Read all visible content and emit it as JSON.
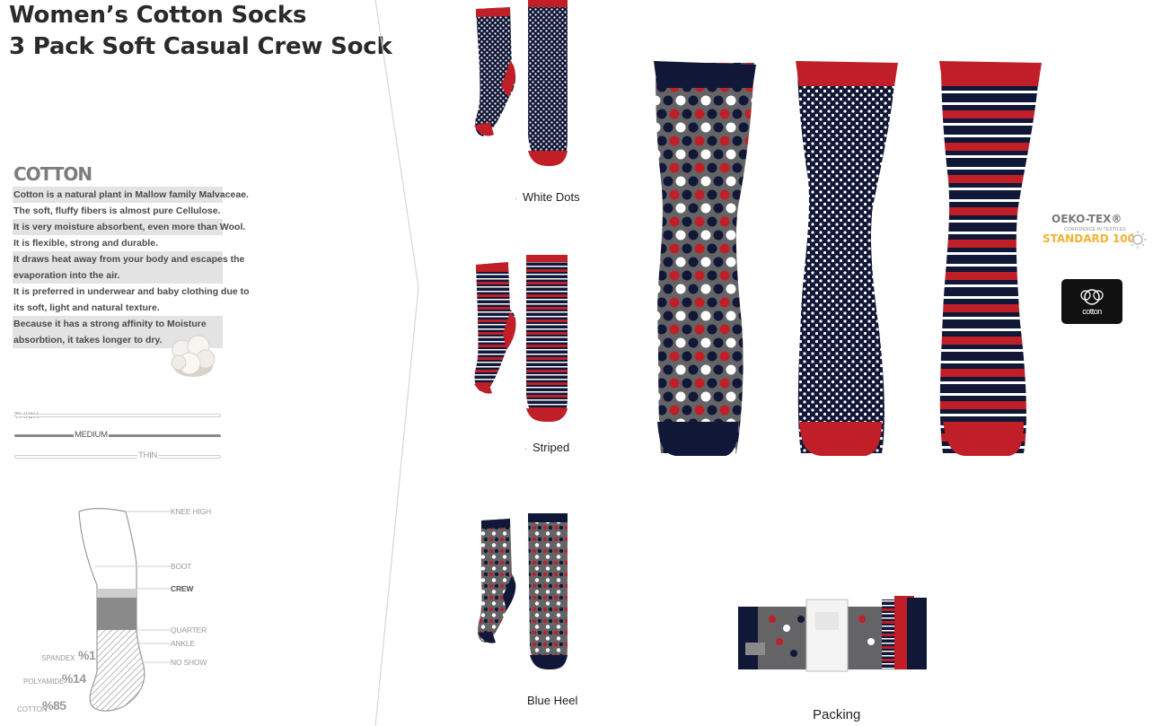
{
  "title": {
    "line1": "Women’s Cotton Socks",
    "line2": "3 Pack Soft Casual Crew Sock"
  },
  "cotton_info": {
    "heading": "COTTON",
    "lines": [
      "Cotton is a natural plant in Mallow family Malvaceae.",
      "The soft, fluffy fibers is almost pure Cellulose.",
      "It is very  moisture absorbent, even more than Wool.",
      "It is flexible, strong and durable.",
      "It draws heat away from your body and escapes the",
      "evaporation  into the air.",
      "It is preferred in underwear and baby clothing due to",
      "its soft, light and natural texture.",
      "Because  it has a strong affinity to Moisture",
      "absorbtion, it takes longer to dry."
    ]
  },
  "thickness": {
    "thick": "THICK",
    "medium": "MEDIUM",
    "thin": "THIN",
    "selected": "MEDIUM"
  },
  "length_chart": {
    "knee_high": "KNEE HIGH",
    "boot": "BOOT",
    "crew": "CREW",
    "quarter": "QUARTER",
    "ankle": "ANKLE",
    "no_show": "NO SHOW",
    "selected": "CREW"
  },
  "composition": {
    "spandex": {
      "name": "SPANDEX",
      "value": "%1"
    },
    "polyamide": {
      "name": "POLYAMIDE",
      "value": "%14"
    },
    "cotton": {
      "name": "COTTON",
      "value": "%85"
    }
  },
  "variants": {
    "white_dots": "White Dots",
    "striped": "Striped",
    "blue_heel": "Blue Heel"
  },
  "packing_label": "Packing",
  "certifications": {
    "oeko_title": "OEKO-TEX®",
    "oeko_sub": "CONFIDENCE IN TEXTILES",
    "oeko_std": "STANDARD 100",
    "cotton_logo": "cotton"
  },
  "colors": {
    "navy": "#111736",
    "red": "#c01f28",
    "grey": "#646467",
    "white": "#ffffff",
    "oeko_orange": "#f2b233"
  }
}
